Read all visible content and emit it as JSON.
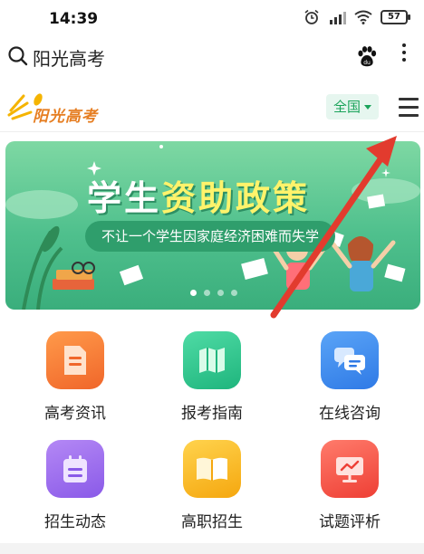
{
  "status_bar": {
    "time": "14:39",
    "battery": "57"
  },
  "browser": {
    "search_text": "阳光高考"
  },
  "site": {
    "logo_text": "阳光高考",
    "region": "全国"
  },
  "banner": {
    "title_white": "学生",
    "title_yellow": "资助政策",
    "subtitle": "不让一个学生因家庭经济困难而失学",
    "slide_count": 4,
    "active_slide": 0
  },
  "grid": [
    {
      "label": "高考资讯",
      "icon": "document-icon",
      "color_from": "#ff9a4a",
      "color_to": "#f0662a"
    },
    {
      "label": "报考指南",
      "icon": "map-icon",
      "color_from": "#4fdba5",
      "color_to": "#1fb57d"
    },
    {
      "label": "在线咨询",
      "icon": "chat-icon",
      "color_from": "#5aa4f7",
      "color_to": "#2f7ae6"
    },
    {
      "label": "招生动态",
      "icon": "calendar-icon",
      "color_from": "#b488f5",
      "color_to": "#8a5ae8"
    },
    {
      "label": "高职招生",
      "icon": "book-icon",
      "color_from": "#ffd34d",
      "color_to": "#f5a70f"
    },
    {
      "label": "试题评析",
      "icon": "presentation-icon",
      "color_from": "#ff7b6b",
      "color_to": "#ee3f35"
    }
  ],
  "colors": {
    "accent_green": "#1aa35a",
    "arrow_red": "#e23b2e"
  }
}
